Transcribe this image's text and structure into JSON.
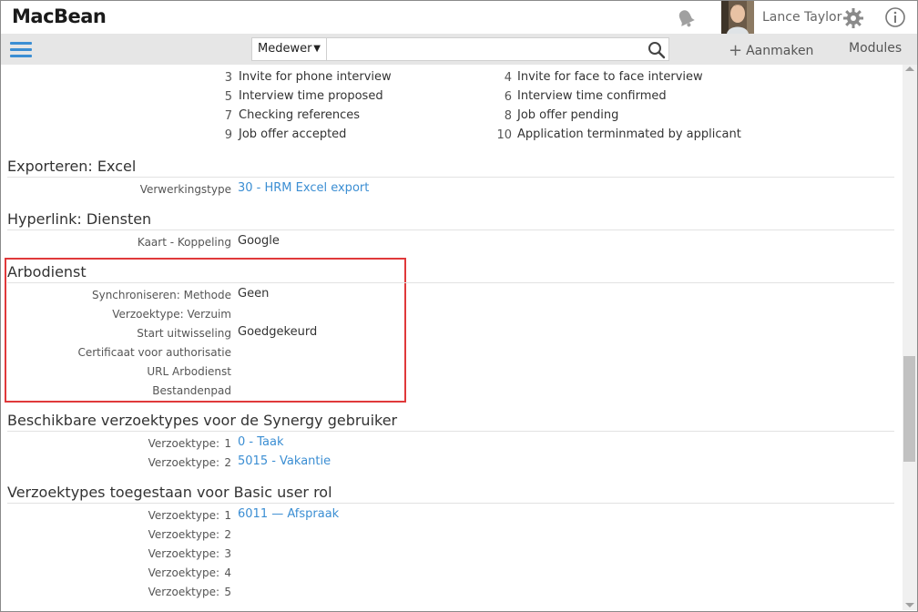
{
  "app": {
    "logo": "MacBean",
    "user_name": "Lance Taylor"
  },
  "toolbar": {
    "search_scope": "Medewer",
    "search_placeholder": "",
    "create_label": "Aanmaken",
    "modules_label": "Modules"
  },
  "statuses": [
    {
      "num": "3",
      "label": "Invite for phone interview"
    },
    {
      "num": "4",
      "label": "Invite for face to face interview"
    },
    {
      "num": "5",
      "label": "Interview time proposed"
    },
    {
      "num": "6",
      "label": "Interview time confirmed"
    },
    {
      "num": "7",
      "label": "Checking references"
    },
    {
      "num": "8",
      "label": "Job offer pending"
    },
    {
      "num": "9",
      "label": "Job offer accepted"
    },
    {
      "num": "10",
      "label": "Application terminmated by applicant"
    }
  ],
  "sections": {
    "export": {
      "title": "Exporteren: Excel",
      "fields": [
        {
          "label": "Verwerkingstype",
          "value": "30 - HRM Excel export"
        }
      ]
    },
    "hyperlink": {
      "title": "Hyperlink: Diensten",
      "fields": [
        {
          "label": "Kaart - Koppeling",
          "value": "Google"
        }
      ]
    },
    "arbodienst": {
      "title": "Arbodienst",
      "fields": [
        {
          "label": "Synchroniseren: Methode",
          "value": "Geen"
        },
        {
          "label": "Verzoektype: Verzuim",
          "value": ""
        },
        {
          "label": "Start uitwisseling",
          "value": "Goedgekeurd"
        },
        {
          "label": "Certificaat voor authorisatie",
          "value": ""
        },
        {
          "label": "URL Arbodienst",
          "value": ""
        },
        {
          "label": "Bestandenpad",
          "value": ""
        }
      ]
    },
    "synergy": {
      "title": "Beschikbare verzoektypes voor de Synergy gebruiker",
      "fields": [
        {
          "label": "Verzoektype:",
          "num": "1",
          "value": "0 - Taak"
        },
        {
          "label": "Verzoektype:",
          "num": "2",
          "value": "5015 - Vakantie"
        }
      ]
    },
    "basic": {
      "title": "Verzoektypes toegestaan voor Basic user rol",
      "fields": [
        {
          "label": "Verzoektype:",
          "num": "1",
          "value": "6011 — Afspraak"
        },
        {
          "label": "Verzoektype:",
          "num": "2",
          "value": ""
        },
        {
          "label": "Verzoektype:",
          "num": "3",
          "value": ""
        },
        {
          "label": "Verzoektype:",
          "num": "4",
          "value": ""
        },
        {
          "label": "Verzoektype:",
          "num": "5",
          "value": ""
        }
      ]
    }
  },
  "colors": {
    "accent": "#3b8ed3",
    "highlight": "#e0393b",
    "toolbar_bg": "#e6e6e6"
  },
  "icons": [
    "menu-icon",
    "bell-icon",
    "gear-icon",
    "info-icon",
    "search-icon",
    "plus-icon"
  ]
}
